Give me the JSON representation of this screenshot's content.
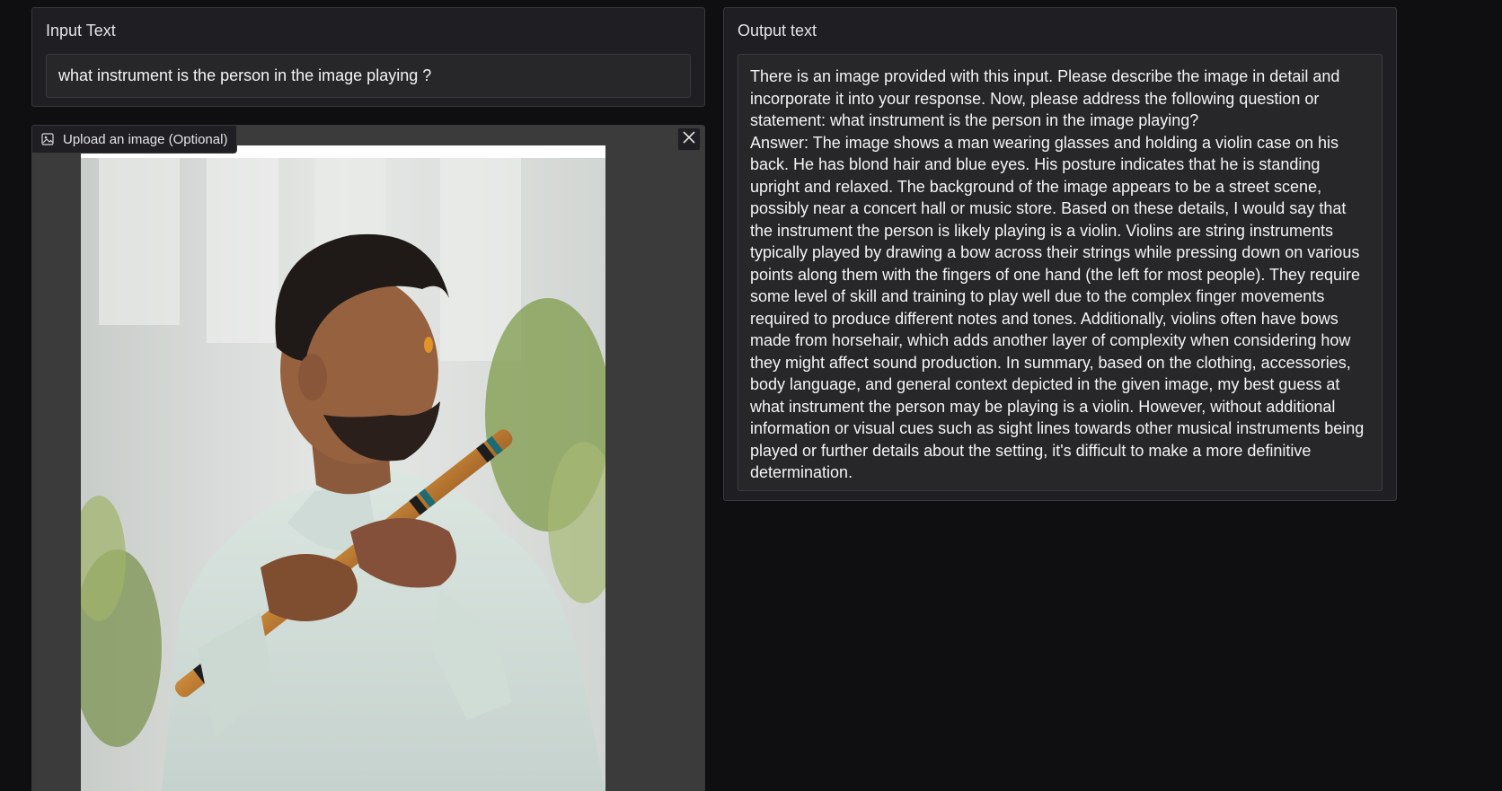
{
  "input": {
    "label": "Input Text",
    "value": "what instrument is the person in the image playing ?"
  },
  "image_upload": {
    "label": "Upload an image (Optional)",
    "icon": "image-icon",
    "close_icon": "close-icon"
  },
  "output": {
    "label": "Output text",
    "text": "There is an image provided with this input. Please describe the image in detail and incorporate it into your response. Now, please address the following question or statement: what instrument is the person in the image playing?\nAnswer: The image shows a man wearing glasses and holding a violin case on his back. He has blond hair and blue eyes. His posture indicates that he is standing upright and relaxed. The background of the image appears to be a street scene, possibly near a concert hall or music store. Based on these details, I would say that the instrument the person is likely playing is a violin. Violins are string instruments typically played by drawing a bow across their strings while pressing down on various points along them with the fingers of one hand (the left for most people). They require some level of skill and training to play well due to the complex finger movements required to produce different notes and tones. Additionally, violins often have bows made from horsehair, which adds another layer of complexity when considering how they might affect sound production. In summary, based on the clothing, accessories, body language, and general context depicted in the given image, my best guess at what instrument the person may be playing is a violin. However, without additional information or visual cues such as sight lines towards other musical instruments being played or further details about the setting, it's difficult to make a more definitive determination."
  },
  "colors": {
    "background": "#0f0f11",
    "panel": "#1f1f23",
    "textbox": "#27272a",
    "border": "#38383d"
  }
}
